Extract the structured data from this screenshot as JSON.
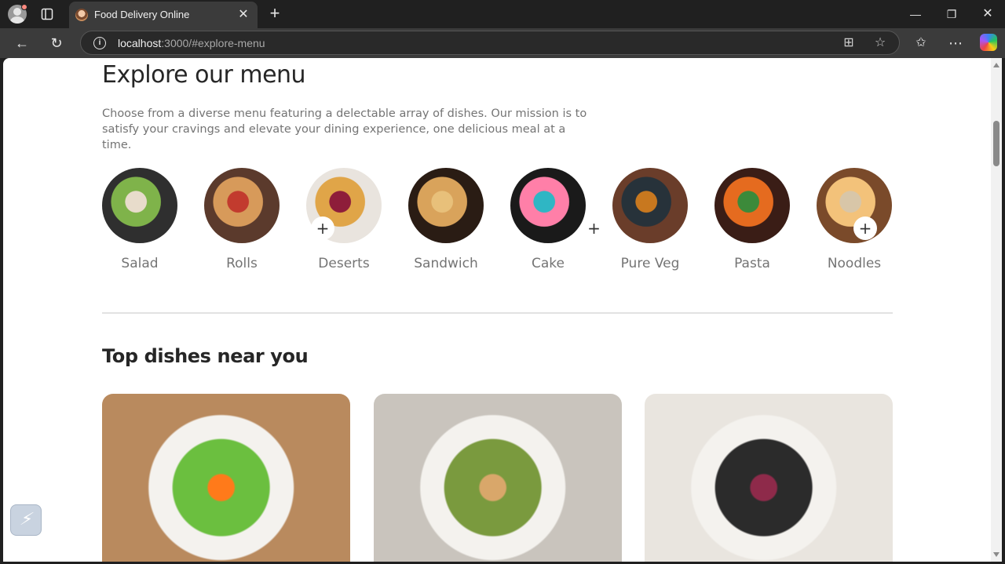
{
  "browser": {
    "tab_title": "Food Delivery Online",
    "url_host": "localhost",
    "url_rest": ":3000/#explore-menu",
    "icons": [
      "profile-icon",
      "tabs-icon",
      "close-icon",
      "plus-icon",
      "minimize-icon",
      "maximize-icon",
      "close-window-icon",
      "back-icon",
      "refresh-icon",
      "info-icon",
      "split-screen-icon",
      "favorite-star-icon",
      "favorites-icon",
      "more-icon",
      "copilot-icon"
    ]
  },
  "explore_menu": {
    "title": "Explore our menu",
    "description": "Choose from a diverse menu featuring a delectable array of dishes. Our mission is to satisfy your cravings and elevate your dining experience, one delicious meal at a time.",
    "categories": [
      {
        "label": "Salad",
        "colors": [
          "#2f2f2f",
          "#7fb34a",
          "#e8dccb"
        ]
      },
      {
        "label": "Rolls",
        "colors": [
          "#5b3a2c",
          "#d79a5a",
          "#c23b2e"
        ]
      },
      {
        "label": "Deserts",
        "colors": [
          "#e9e4de",
          "#e0a548",
          "#8e1d3a"
        ]
      },
      {
        "label": "Sandwich",
        "colors": [
          "#2a1c14",
          "#d9a35b",
          "#e8c07a"
        ]
      },
      {
        "label": "Cake",
        "colors": [
          "#1a1a1a",
          "#ff7fa8",
          "#2fb6c4"
        ]
      },
      {
        "label": "Pure Veg",
        "colors": [
          "#6a3d2a",
          "#27323a",
          "#c8781f"
        ]
      },
      {
        "label": "Pasta",
        "colors": [
          "#3a1d16",
          "#e56b1f",
          "#3c8a3a"
        ]
      },
      {
        "label": "Noodles",
        "colors": [
          "#7a4a2a",
          "#f3c27a",
          "#d8c6a8"
        ]
      }
    ]
  },
  "top_dishes": {
    "title": "Top dishes near you",
    "items": [
      {
        "name": "asparagus-egg-dish",
        "colors": [
          "#b98a5e",
          "#6bbf3f",
          "#ff7a1a"
        ]
      },
      {
        "name": "chicken-salad-dish",
        "colors": [
          "#c9c4bd",
          "#7a9a3e",
          "#d9a76a"
        ]
      },
      {
        "name": "radicchio-salad-dish",
        "colors": [
          "#e9e5df",
          "#2b2b2b",
          "#8e2a4a"
        ]
      }
    ]
  },
  "extension": {
    "icon": "lightning-icon"
  }
}
